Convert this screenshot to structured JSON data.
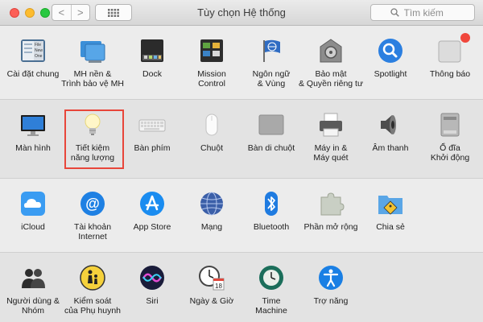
{
  "window": {
    "title": "Tùy chọn Hệ thống"
  },
  "toolbar": {
    "back": "<",
    "forward": ">"
  },
  "search": {
    "placeholder": "Tìm kiếm"
  },
  "rows": [
    [
      {
        "label": "Cài đặt chung",
        "icon": "general-icon"
      },
      {
        "label": "MH nền &\nTrình bảo vệ MH",
        "icon": "desktop-screensaver-icon"
      },
      {
        "label": "Dock",
        "icon": "dock-icon"
      },
      {
        "label": "Mission\nControl",
        "icon": "mission-control-icon"
      },
      {
        "label": "Ngôn ngữ\n& Vùng",
        "icon": "language-region-icon"
      },
      {
        "label": "Bảo mật\n& Quyền riêng tư",
        "icon": "security-privacy-icon"
      },
      {
        "label": "Spotlight",
        "icon": "spotlight-icon"
      },
      {
        "label": "Thông báo",
        "icon": "notifications-icon"
      }
    ],
    [
      {
        "label": "Màn hình",
        "icon": "displays-icon"
      },
      {
        "label": "Tiết kiệm\nnăng lượng",
        "icon": "energy-saver-icon"
      },
      {
        "label": "Bàn phím",
        "icon": "keyboard-icon"
      },
      {
        "label": "Chuột",
        "icon": "mouse-icon"
      },
      {
        "label": "Bàn di chuột",
        "icon": "trackpad-icon"
      },
      {
        "label": "Máy in &\nMáy quét",
        "icon": "printers-scanners-icon"
      },
      {
        "label": "Âm thanh",
        "icon": "sound-icon"
      },
      {
        "label": "Ổ đĩa\nKhởi động",
        "icon": "startup-disk-icon"
      }
    ],
    [
      {
        "label": "iCloud",
        "icon": "icloud-icon"
      },
      {
        "label": "Tài khoản\nInternet",
        "icon": "internet-accounts-icon"
      },
      {
        "label": "App Store",
        "icon": "app-store-icon"
      },
      {
        "label": "Mạng",
        "icon": "network-icon"
      },
      {
        "label": "Bluetooth",
        "icon": "bluetooth-icon"
      },
      {
        "label": "Phần mở rộng",
        "icon": "extensions-icon"
      },
      {
        "label": "Chia sẻ",
        "icon": "sharing-icon"
      }
    ],
    [
      {
        "label": "Người dùng &\nNhóm",
        "icon": "users-groups-icon"
      },
      {
        "label": "Kiểm soát\ncủa Phụ huynh",
        "icon": "parental-controls-icon"
      },
      {
        "label": "Siri",
        "icon": "siri-icon"
      },
      {
        "label": "Ngày & Giờ",
        "icon": "date-time-icon"
      },
      {
        "label": "Time\nMachine",
        "icon": "time-machine-icon"
      },
      {
        "label": "Trợ năng",
        "icon": "accessibility-icon"
      }
    ]
  ],
  "calendar_day": "18",
  "file_icon_text": [
    "File",
    "New",
    "One"
  ],
  "colors": {
    "highlight": "#e8463a",
    "accent": "#1b8cf0"
  }
}
